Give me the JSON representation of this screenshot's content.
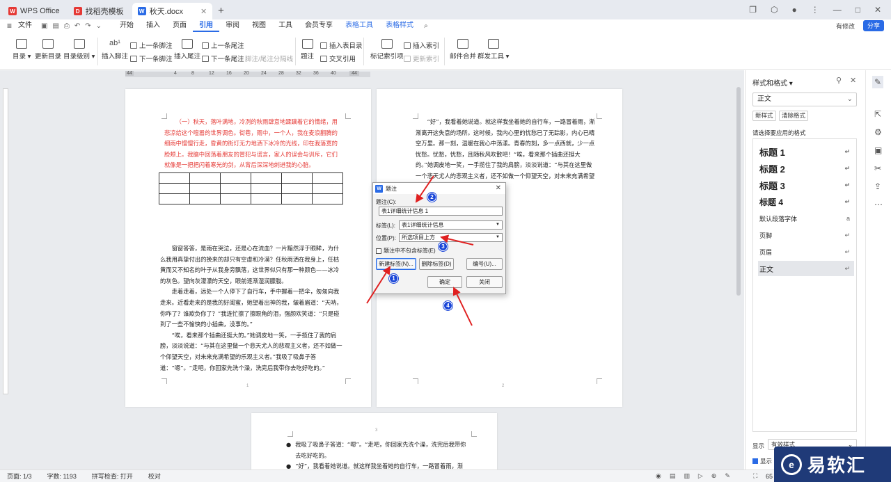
{
  "titlebar": {
    "tabs": [
      {
        "label": "WPS Office",
        "icon": "wps-logo-icon"
      },
      {
        "label": "找稻壳模板",
        "icon": "docer-icon"
      },
      {
        "label": "秋天.docx",
        "icon": "word-doc-icon"
      }
    ],
    "new_tab": "+"
  },
  "menubar": {
    "file": "文件",
    "items": [
      "开始",
      "插入",
      "页面",
      "引用",
      "审阅",
      "视图",
      "工具",
      "会员专享",
      "表格工具",
      "表格样式"
    ],
    "active": "引用",
    "modified": "有修改",
    "share": "分享"
  },
  "ribbon": {
    "toc": "目录",
    "update_toc": "更新目录",
    "toc_level": "目录级别",
    "insert_footnote": "插入脚注",
    "prev_footnote": "上一条脚注",
    "next_footnote": "下一条脚注",
    "insert_endnote": "插入尾注",
    "prev_endnote": "上一条尾注",
    "next_endnote": "下一条尾注",
    "footnote_sep": "脚注/尾注分隔线",
    "caption": "题注",
    "insert_table_of_figures": "插入表目录",
    "cross_ref": "交叉引用",
    "mark_index": "标记索引项",
    "insert_index": "插入索引",
    "update_index": "更新索引",
    "mail_merge": "邮件合并",
    "group_tools": "群发工具"
  },
  "ruler": [
    "44",
    "4",
    "8",
    "12",
    "16",
    "20",
    "24",
    "28",
    "32",
    "36",
    "40",
    "44"
  ],
  "page1": {
    "red_paragraph": "（一）秋天，落叶满地，冷冽的秋雨肆意地蹂躏着它的情绪，用悲凉给这个喧嚣的世界调色。街巷，雨中，一个人，我在麦浪翻腾的细雨中慢慢行走，昏黄的街灯无力地洒下冰冷的光线，印在我落寞的脸颊上。我脑中回荡着朋友的冒犯与谎言，家人的误会与训斥，它们就像是一把把闪着寒光的剑，从背后深深地刺进我的心脏。",
    "paragraphs": [
      "窗窗答答，是雨在哭泣，还是心在流血？一片黯然浮于眼眸，为什么我用真挚付出的换来的却只有空虚和冷漠？任秋雨洒在我身上，任枯黄而又不知名的叶子从我身旁飘落，这世界似只有那一种颜色——冰冷的灰色。望向灰濛濛的天空，眼前逐渐湿润朦胧。",
      "走着走着，远处一个人停下了自行车，手中握着一把伞，匆匆向我走来。近看走来的是我的好闺蜜，她望着出神的我，皱着眉道：“天呐，你咋了？谁欺负你了？”我连忙擦了擦眼角的泪，强颜欢笑道：“只是碰到了一些不愉快的小插曲，没事的。”",
      "“唉，看来那个插曲还挺大的。”她调皮地一笑，一手揽住了我的肩膀，淡淡说道：“与其在这里做一个悲天尤人的悲观主义者，还不如做一个仰望天空，对未来充满希望的乐观主义者。”我吸了吸鼻子答道：“嗯”。“走吧，你回家先洗个澡，洗完后我带你去吃好吃的。”"
    ],
    "page_number": "1"
  },
  "page2": {
    "paragraph": "“好”，我看着她说道。就这样我坐着她的自行车，一路冒着雨，渐渐离开这失意的场所。这时候，我内心里的忧愁已了无踪影，内心已晴空万里。那一刻，温暖在我心中荡漾。青春的刻，多一点西就，少一点忧愁。忧愁，忧愁，且随秋风吹散吧！“唉，看来那个插曲还挺大的。”她调皮地一笑，一手揽住了我的肩膀，淡淡说道：“与其在这里做一个悲天尤人的悲观主义者，还不如做一个仰望天空，对未来充满希望的乐观主义者。”",
    "page_number": "2"
  },
  "page3": {
    "bullets": [
      "我吸了吸鼻子答道：“嗯”。“走吧，你回家先洗个澡，洗完后我带你去吃好吃的。",
      "“好”，我看着她说道。就这样我坐着她的自行车，一路冒着雨，渐渐"
    ],
    "page_number": "3"
  },
  "dialog": {
    "title": "题注",
    "caption_label": "题注(C):",
    "caption_value": "表1详细统计信息 1",
    "label_label": "标签(L):",
    "label_value": "表1详细统计信息",
    "position_label": "位置(P):",
    "position_value": "所选项目上方",
    "exclude_label": "题注中不包含标签(E)",
    "new_label_btn": "新建标签(N)...",
    "delete_label_btn": "删除标签(D)",
    "numbering_btn": "编号(U)...",
    "ok_btn": "确定",
    "close_btn": "关闭"
  },
  "annotations": [
    "1",
    "2",
    "3",
    "4"
  ],
  "right_panel": {
    "title": "样式和格式",
    "current_style": "正文",
    "new_style": "新样式",
    "clear_format": "清除格式",
    "prompt": "请选择要应用的格式",
    "styles": [
      "标题 1",
      "标题 2",
      "标题 3",
      "标题 4",
      "默认段落字体",
      "页脚",
      "页眉",
      "正文"
    ],
    "selected_style": "正文",
    "show_label": "显示",
    "show_value": "有效样式",
    "show_preview": "显示"
  },
  "statusbar": {
    "page": "页面: 1/3",
    "words": "字数: 1193",
    "spellcheck": "拼写检查: 打开",
    "proof": "校对",
    "zoom": "65"
  },
  "watermark": {
    "text": "易软汇"
  },
  "colors": {
    "accent": "#2a6be6",
    "annotation": "#1a46d8",
    "arrow": "#e02020",
    "red_text": "#e53935"
  }
}
